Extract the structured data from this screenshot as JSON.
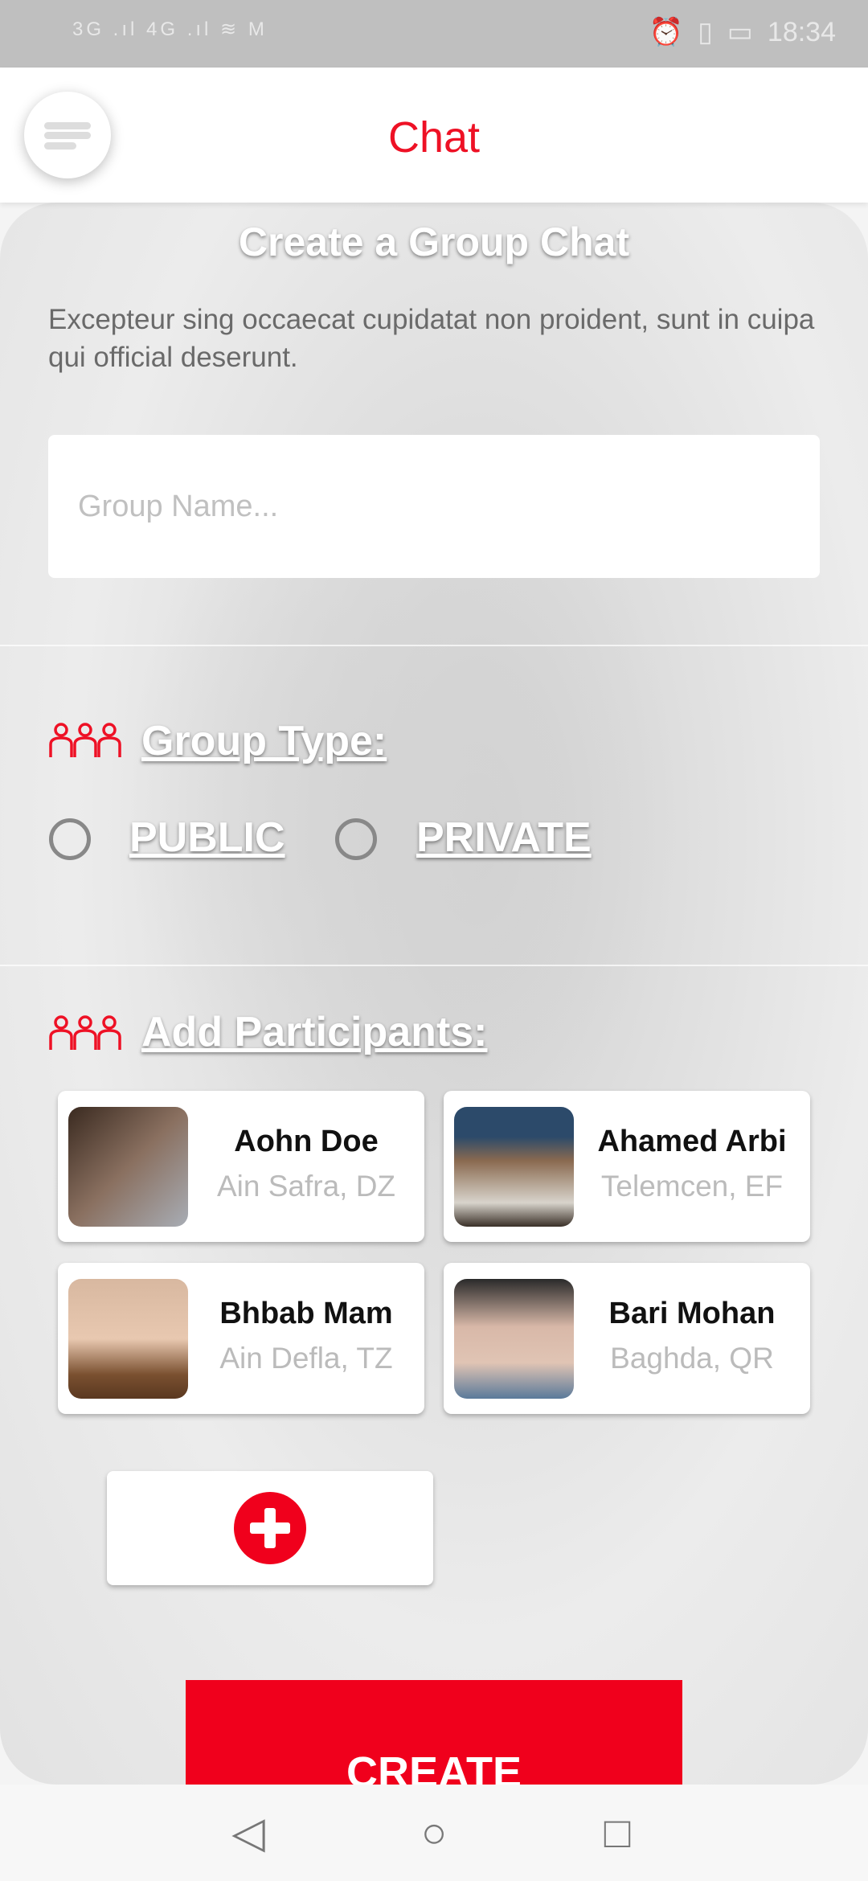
{
  "status_bar": {
    "left": "3G .ıl 4G .ıl ≋ M",
    "time": "18:34"
  },
  "header": {
    "title": "Chat"
  },
  "form": {
    "title": "Create a Group Chat",
    "description": "Excepteur sing occaecat cupidatat non proident, sunt in cuipa qui official deserunt.",
    "group_name_placeholder": "Group Name...",
    "group_type_label": "Group Type:",
    "options": [
      "PUBLIC",
      "PRIVATE"
    ],
    "participants_label": "Add Participants:",
    "participants": [
      {
        "name": "Aohn Doe",
        "location": "Ain Safra, DZ"
      },
      {
        "name": "Ahamed Arbi",
        "location": "Telemcen, EF"
      },
      {
        "name": "Bhbab Mam",
        "location": "Ain Defla, TZ"
      },
      {
        "name": "Bari Mohan",
        "location": "Baghda, QR"
      }
    ],
    "create_label": "CREATE"
  },
  "colors": {
    "accent": "#f0001c"
  }
}
